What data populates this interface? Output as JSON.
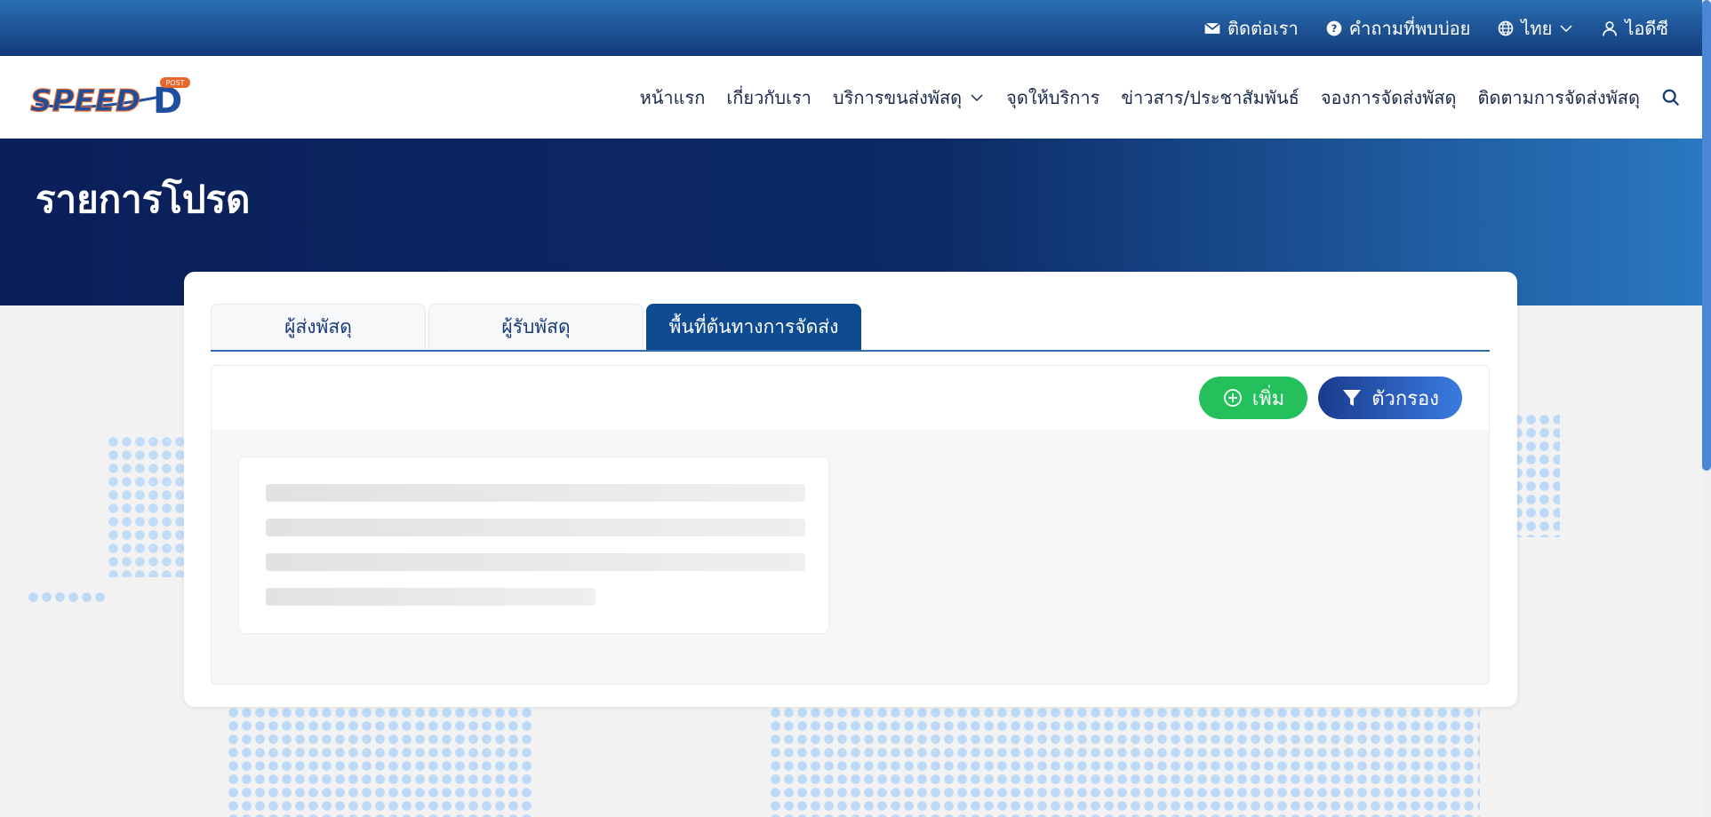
{
  "topbar": {
    "contact": "ติดต่อเรา",
    "faq": "คำถามที่พบบ่อย",
    "language": "ไทย",
    "user": "ไอดีซี"
  },
  "logo": {
    "text": "SPEED",
    "letter": "D",
    "badge": "POST"
  },
  "nav": {
    "items": [
      "หน้าแรก",
      "เกี่ยวกับเรา",
      "บริการขนส่งพัสดุ",
      "จุดให้บริการ",
      "ข่าวสาร/ประชาสัมพันธ์",
      "จองการจัดส่งพัสดุ",
      "ติดตามการจัดส่งพัสดุ"
    ]
  },
  "hero": {
    "title": "รายการโปรด"
  },
  "tabs": [
    {
      "label": "ผู้ส่งพัสดุ",
      "active": false
    },
    {
      "label": "ผู้รับพัสดุ",
      "active": false
    },
    {
      "label": "พื้นที่ต้นทางการจัดส่ง",
      "active": true
    }
  ],
  "toolbar": {
    "add_label": "เพิ่ม",
    "filter_label": "ตัวกรอง"
  },
  "colors": {
    "primary": "#0e4b91",
    "add": "#23c05b",
    "hero": "#0b1f5a"
  },
  "icons": [
    "envelope-icon",
    "question-circle-icon",
    "globe-icon",
    "chevron-down-icon",
    "user-icon",
    "search-icon",
    "plus-circle-icon",
    "filter-icon"
  ]
}
